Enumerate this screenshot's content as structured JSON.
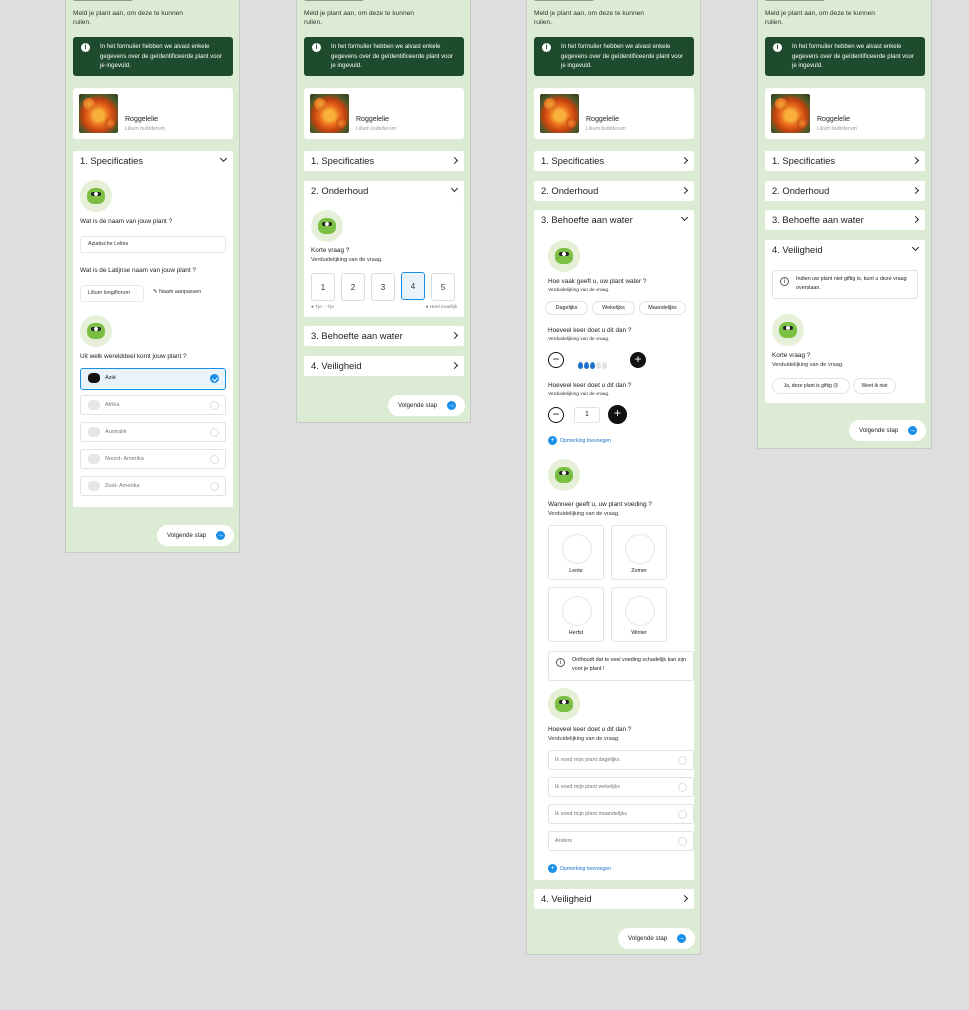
{
  "intro": "Meld je plant aan, om deze te kunnen ruilen.",
  "info": "In het formulier hebben we alvast enkele gegevens over de geïdentificeerde plant voor je ingevuld.",
  "plant": {
    "name": "Roggelelie",
    "latin": "Lilium bulbiferum"
  },
  "sections": {
    "s1": "1.  Specificaties",
    "s2": "2.  Onderhoud",
    "s3": "3.  Behoefte aan water",
    "s4": "4.  Veiligheid",
    "s4b": "4. Veiligheid"
  },
  "next": "Volgende stap",
  "f1": {
    "q_name": "Wat is de naam van jouw plant ?",
    "v_name": "Aziatische Lelies",
    "q_latin": "Wat is de Latijnse naam van jouw plant ?",
    "v_latin": "Lilium longiflorum",
    "edit": "Naam aanpassen",
    "q_region": "Uit welk werelddeel komt jouw plant ?",
    "regions": [
      "Azië",
      "Afrika",
      "Australië",
      "Noord- Amerika",
      "Zuid- Amerika"
    ]
  },
  "f2": {
    "q": "Korte vraag ?",
    "sub": "Verduidelijking van de vraag.",
    "hands": [
      "1",
      "2",
      "3",
      "4",
      "5"
    ],
    "easy": "Tje",
    "easy2": "Tje",
    "hard": "Heel moeilijk"
  },
  "f3": {
    "q1": "Hoe vaak geeft u, uw plant water ?",
    "sub": "Verduidelijking van de vraag.",
    "chips": [
      "Dagelijks",
      "Wekelijks",
      "Maandelijks"
    ],
    "q2": "Hoeveel keer doet u dit dan ?",
    "q3": "Hoeveel keer doet u dit dan ?",
    "count": "1",
    "remark": "Opmerking toevoegen",
    "q4": "Wanneer geeft u, uw plant voeding ?",
    "seasons": [
      "Lente",
      "Zomer",
      "Herfst",
      "Winter"
    ],
    "note": "Onthoudt dat te veel voeding schadelijk kan zijn voor je plant !",
    "q5": "Hoeveel keer doet u dit dan ?",
    "freq": [
      "Ik voed mijn plant dagelijks",
      "Ik voed mijn plant wekelijks",
      "Ik voed mijn plant maandelijks",
      "Anders"
    ]
  },
  "f4": {
    "note": "Indien uw plant niet giftig is, kunt u deze vraag overslaan.",
    "q": "Korte vraag ?",
    "sub": "Verduidelijking van de vraag.",
    "yes": "Ja, deze plant is giftig",
    "no": "Weet ik niet"
  }
}
